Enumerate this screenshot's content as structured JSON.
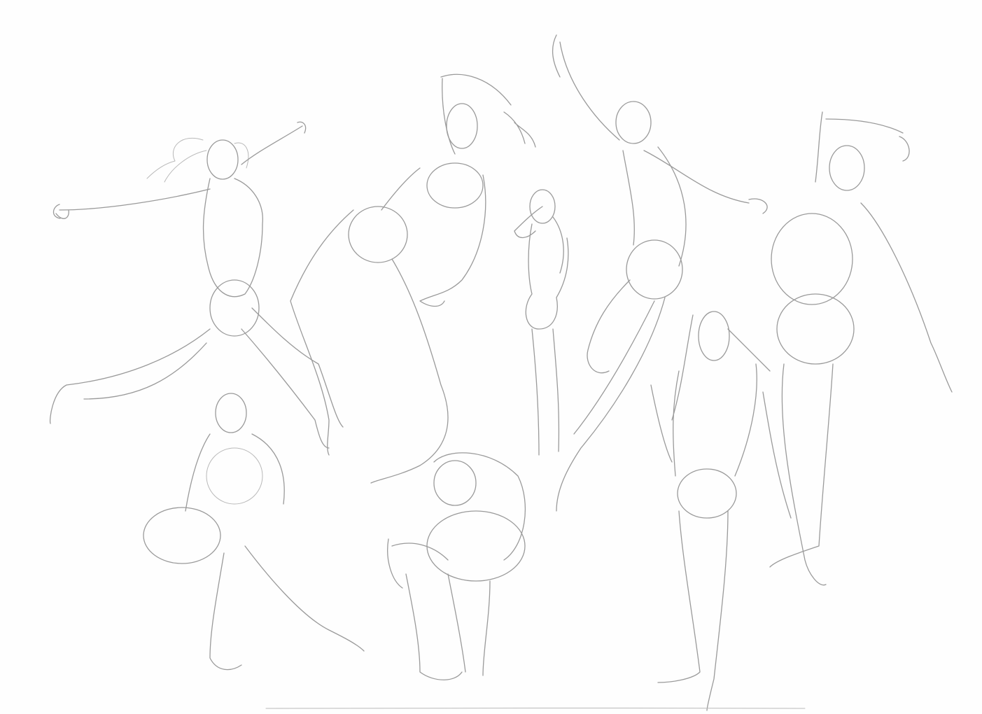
{
  "sheet": {
    "paper_color": "#fefefe",
    "pencil_color": "#9a9a9a",
    "figures": [
      {
        "pose": "leaping-arms-outstretched",
        "icon": "figure-sketch-icon"
      },
      {
        "pose": "lunging-arm-raised",
        "icon": "figure-sketch-icon"
      },
      {
        "pose": "standing-hand-on-head",
        "icon": "figure-sketch-icon"
      },
      {
        "pose": "balancing-arm-raised",
        "icon": "figure-sketch-icon"
      },
      {
        "pose": "standing-arms-up",
        "icon": "figure-sketch-icon"
      },
      {
        "pose": "seated-crouch",
        "icon": "figure-sketch-icon"
      },
      {
        "pose": "squatting-head-down",
        "icon": "figure-sketch-icon"
      },
      {
        "pose": "standing-contrapposto",
        "icon": "figure-sketch-icon"
      }
    ]
  }
}
